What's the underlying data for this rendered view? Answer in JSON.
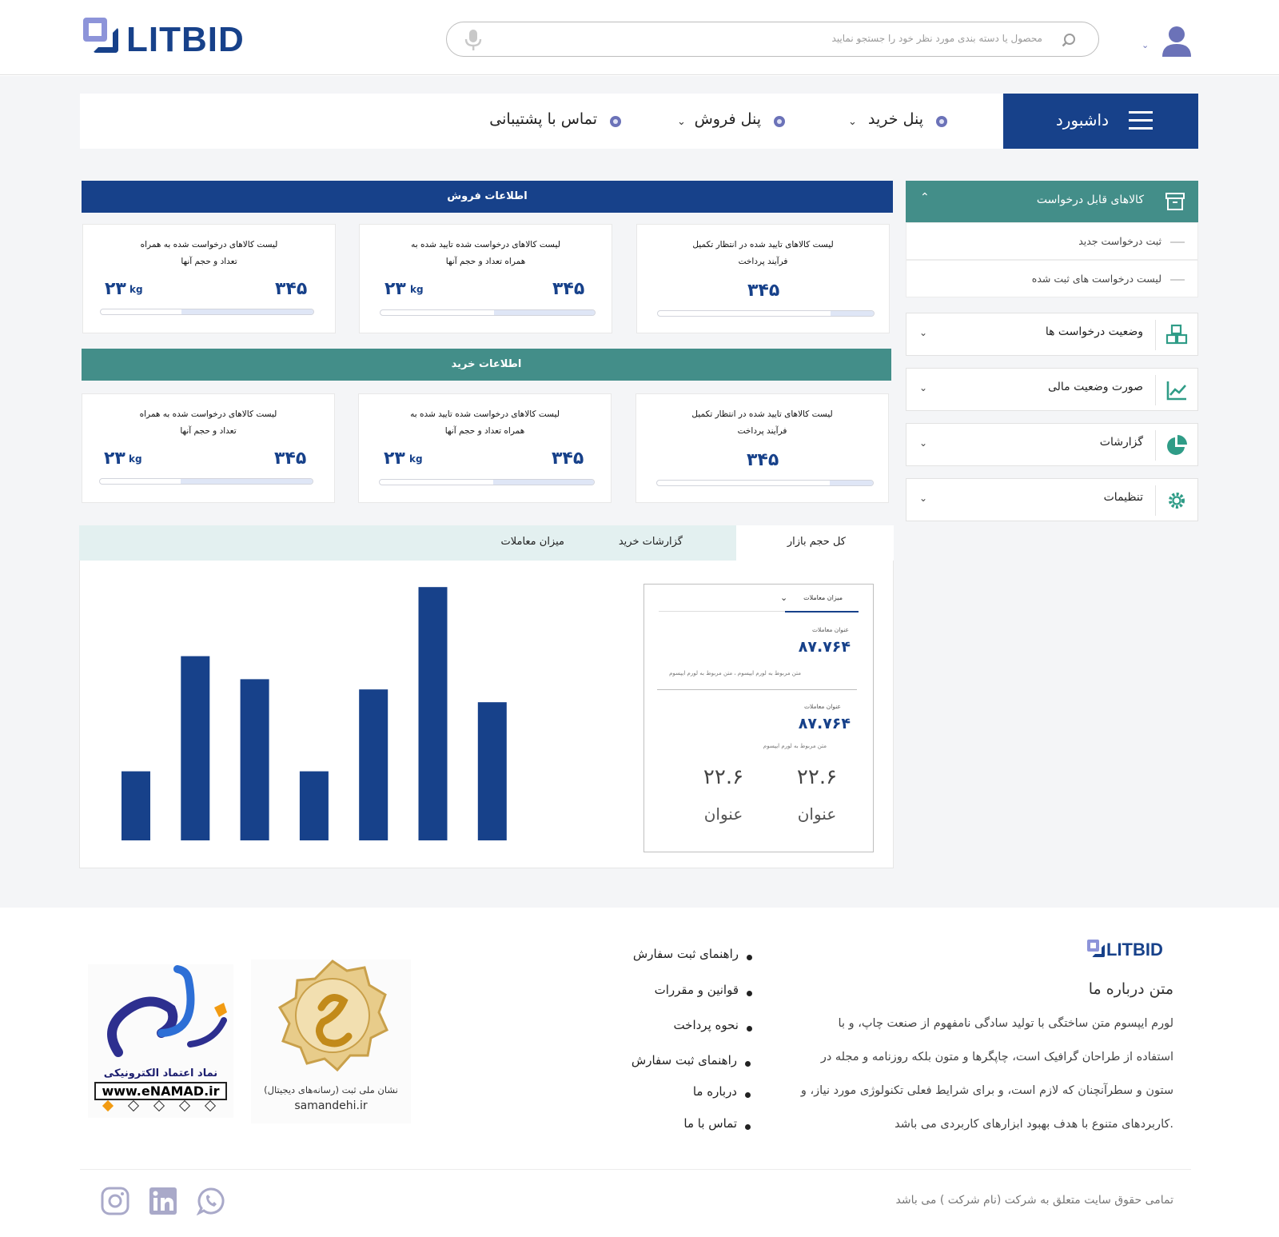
{
  "header": {
    "logo_text": "LITBID",
    "search_placeholder": "محصول یا دسته بندی مورد نظر خود را جستجو نمایید",
    "icons": [
      "user-icon",
      "mic-icon",
      "search-icon",
      "chevron-down-icon"
    ]
  },
  "nav": {
    "dashboard_label": "داشبورد",
    "items": [
      {
        "label": "پنل خرید",
        "has_dropdown": true
      },
      {
        "label": "پنل فروش",
        "has_dropdown": true
      },
      {
        "label": "تماس با پشتیبانی",
        "has_dropdown": false
      }
    ]
  },
  "sidebar": {
    "active_section": "کالاهای قابل درخواست",
    "sub_items": [
      "ثبت درخواست جدید",
      "لیست درخواست های  ثبت شده"
    ],
    "sections": [
      {
        "label": "وضعیت درخواست ها",
        "icon": "cubes-icon"
      },
      {
        "label": "صورت وضعیت مالی",
        "icon": "chart-line-icon"
      },
      {
        "label": "گزارشات",
        "icon": "pie-chart-icon"
      },
      {
        "label": "تنظیمات",
        "icon": "gear-icon"
      }
    ],
    "colors": {
      "active_bg": "#438e89",
      "icon": "#2f9c87"
    }
  },
  "sales": {
    "title": "اطلاعات فروش",
    "cards": [
      {
        "title": "لیست کالاهای تایید شده در انتظار تکمیل فرآیند پرداخت",
        "count": "۳۴۵",
        "progress": 0.2
      },
      {
        "title": "لیست کالاهای درخواست شده تایید شده به همراه تعداد و حجم آنها",
        "count": "۳۴۵",
        "weight": "۲۳",
        "unit": "kg",
        "progress": 0.47
      },
      {
        "title": "لیست کالاهای درخواست شده به همراه تعداد و حجم آنها",
        "count": "۳۴۵",
        "weight": "۲۳",
        "unit": "kg",
        "progress": 0.62
      }
    ]
  },
  "purchase": {
    "title": "اطلاعات خرید",
    "cards": [
      {
        "title": "لیست کالاهای تایید شده در انتظار تکمیل فرآیند پرداخت",
        "count": "۳۴۵",
        "progress": 0.2
      },
      {
        "title": "لیست کالاهای درخواست شده تایید شده به همراه تعداد و حجم آنها",
        "count": "۳۴۵",
        "weight": "۲۳",
        "unit": "kg",
        "progress": 0.47
      },
      {
        "title": "لیست کالاهای درخواست شده به همراه تعداد و حجم آنها",
        "count": "۳۴۵",
        "weight": "۲۳",
        "unit": "kg",
        "progress": 0.62
      }
    ]
  },
  "tabs": [
    {
      "label": "کل حجم بازار",
      "active": true
    },
    {
      "label": "گزارشات خرید",
      "active": false
    },
    {
      "label": "میزان معاملات",
      "active": false
    }
  ],
  "stat_panel": {
    "select_label": "میزان معاملات",
    "blocks": [
      {
        "title": "عنوان معاملات",
        "value": "۸۷.۷۶۴",
        "desc": "متن مربوط به لورم ایپسوم ، متن مربوط به لورم ایپسوم"
      },
      {
        "title": "عنوان معاملات",
        "value": "۸۷.۷۶۴",
        "desc": "متن مربوط به لورم ایپسوم"
      }
    ],
    "metrics": [
      {
        "value": "۲۲.۶",
        "label": "عنوان"
      },
      {
        "value": "۲۲.۶",
        "label": "عنوان"
      }
    ]
  },
  "chart_data": {
    "type": "bar",
    "categories": [
      "",
      "",
      "",
      "",
      "",
      "",
      ""
    ],
    "values": [
      27,
      72,
      63,
      27,
      59,
      99,
      54
    ],
    "ylim": [
      0,
      100
    ],
    "title": "",
    "xlabel": "",
    "ylabel": "",
    "grid": false,
    "color": "#17418a"
  },
  "footer": {
    "logo_text": "LITBID",
    "about_title": "متن درباره ما",
    "about_lines": [
      "لورم ایپسوم متن ساختگی با تولید سادگی نامفهوم از صنعت چاپ، و با",
      "استفاده از طراحان گرافیک است، چاپگرها و متون بلکه روزنامه و مجله در",
      "ستون و سطرآنچنان که لازم است، و برای شرایط فعلی تکنولوژی مورد نیاز، و",
      "کاربردهای متنوع با هدف بهبود ابزارهای کاربردی می باشد."
    ],
    "links": [
      "راهنمای ثبت سفارش",
      "قوانین و مقررات",
      "نحوه پرداخت",
      "راهنمای ثبت سفارش",
      "درباره ما",
      "تماس با ما"
    ],
    "samandehi_caption": "نشان ملی ثبت (رسانه‌های دیجیتال)",
    "samandehi_site": "samandehi.ir",
    "enamad_caption": "نماد اعتماد الکترونیکی",
    "enamad_site": "www.eNAMAD.ir",
    "copyright": "تمامی حقوق سایت متعلق به شرکت  (نام شرکت ) می باشد",
    "social": [
      "instagram-icon",
      "linkedin-icon",
      "whatsapp-icon"
    ]
  },
  "colors": {
    "primary": "#17418a",
    "teal": "#438e89",
    "accent": "#6b72b8"
  }
}
